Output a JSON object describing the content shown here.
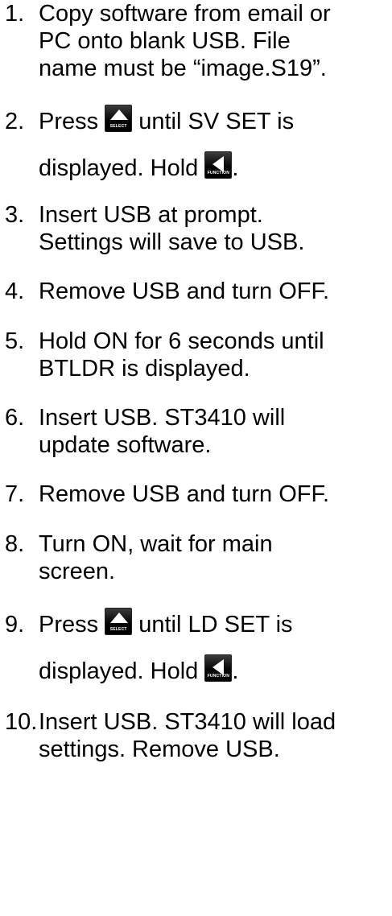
{
  "steps": [
    {
      "num": "1.",
      "lines": [
        "Copy software from email or",
        "PC onto blank USB.  File",
        "name must be “image.S19”."
      ]
    },
    {
      "num": "2.",
      "a1": "Press ",
      "a2": " until SV SET is",
      "b1": "displayed. Hold ",
      "b2": "."
    },
    {
      "num": "3.",
      "lines": [
        "Insert USB at prompt.",
        "Settings will save to USB."
      ]
    },
    {
      "num": "4.",
      "lines": [
        "Remove USB and turn OFF."
      ]
    },
    {
      "num": "5.",
      "lines": [
        "Hold ON for 6 seconds until",
        "BTLDR is displayed."
      ]
    },
    {
      "num": "6.",
      "lines": [
        "Insert USB.  ST3410 will",
        "update software."
      ]
    },
    {
      "num": "7.",
      "lines": [
        "Remove USB and turn OFF."
      ]
    },
    {
      "num": "8.",
      "lines": [
        "Turn ON, wait for main",
        "screen."
      ]
    },
    {
      "num": "9.",
      "a1": "Press ",
      "a2": " until LD SET is",
      "b1": "displayed.  Hold ",
      "b2": "."
    },
    {
      "num": "10.",
      "lines": [
        "Insert USB.  ST3410 will load",
        "settings.  Remove USB."
      ]
    }
  ],
  "icons": {
    "select": {
      "label": "SELECT",
      "icon": "triangle-up-icon"
    },
    "function": {
      "label": "FUNCTION",
      "icon": "triangle-left-icon"
    }
  }
}
